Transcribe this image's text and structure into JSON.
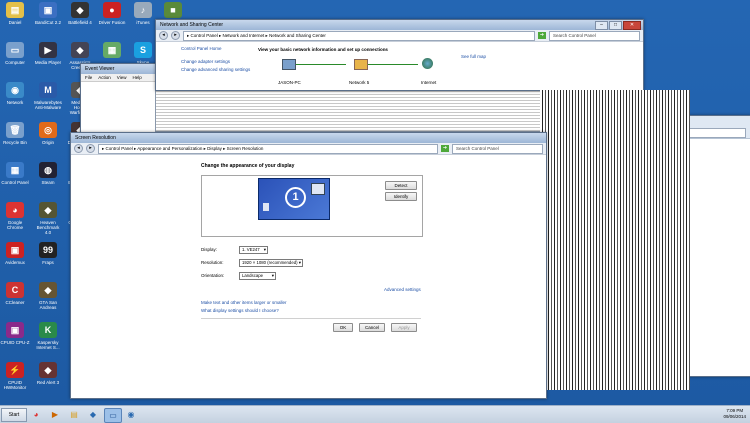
{
  "desktop": {
    "icons": [
      {
        "label": "Daniel",
        "glyph": "▤",
        "color": "#e3c04a"
      },
      {
        "label": "BandiCut 2.2",
        "glyph": "▣",
        "color": "#3b6fc2"
      },
      {
        "label": "Battlefield 4",
        "glyph": "◆",
        "color": "#333"
      },
      {
        "label": "Driver Fusion",
        "glyph": "●",
        "color": "#c22"
      },
      {
        "label": "iTunes",
        "glyph": "♪",
        "color": "#9ab"
      },
      {
        "label": "Minecraft",
        "glyph": "■",
        "color": "#5a8a3a"
      },
      {
        "label": "Computer",
        "glyph": "▭",
        "color": "#7aa0cc"
      },
      {
        "label": "Media Player",
        "glyph": "▶",
        "color": "#334"
      },
      {
        "label": "Assassin's Creed IV",
        "glyph": "◆",
        "color": "#445"
      },
      {
        "label": "",
        "glyph": "▦",
        "color": "#6a6"
      },
      {
        "label": "Skype",
        "glyph": "S",
        "color": "#1aa0e0"
      },
      {
        "label": "Speccy",
        "glyph": "▣",
        "color": "#c33"
      },
      {
        "label": "Network",
        "glyph": "◉",
        "color": "#3a8ac8"
      },
      {
        "label": "Malwarebytes Anti-Malware",
        "glyph": "M",
        "color": "#2a5aa8"
      },
      {
        "label": "Medal of Honor Warfighter",
        "glyph": "◆",
        "color": "#555"
      },
      {
        "label": "Recycle Bin",
        "glyph": "🗑",
        "color": "#7aa0cc"
      },
      {
        "label": "Origin",
        "glyph": "◎",
        "color": "#e06a1a"
      },
      {
        "label": "Dead Space",
        "glyph": "◆",
        "color": "#433"
      },
      {
        "label": "Control Panel",
        "glyph": "▦",
        "color": "#3a7ac8"
      },
      {
        "label": "Steam",
        "glyph": "◍",
        "color": "#223"
      },
      {
        "label": "Battlefield 3",
        "glyph": "◆",
        "color": "#555"
      },
      {
        "label": "Google Chrome",
        "glyph": "◕",
        "color": "#d33"
      },
      {
        "label": "Heaven Benchmark 4.0",
        "glyph": "◆",
        "color": "#553"
      },
      {
        "label": "Call of Duty",
        "glyph": "◆",
        "color": "#444"
      },
      {
        "label": "Avidemux",
        "glyph": "▣",
        "color": "#c22"
      },
      {
        "label": "Fraps",
        "glyph": "99",
        "color": "#222"
      },
      {
        "label": "Bioshock",
        "glyph": "◆",
        "color": "#446"
      },
      {
        "label": "CCleaner",
        "glyph": "C",
        "color": "#c33"
      },
      {
        "label": "GTA San Andreas",
        "glyph": "◆",
        "color": "#653"
      },
      {
        "label": "Bioshock",
        "glyph": "◆",
        "color": "#446"
      },
      {
        "label": "CPUID CPU-Z",
        "glyph": "▣",
        "color": "#8a2a8a"
      },
      {
        "label": "Kaspersky Internet S...",
        "glyph": "K",
        "color": "#2a8a4a"
      },
      {
        "label": "Crysis",
        "glyph": "◆",
        "color": "#444"
      },
      {
        "label": "CPUID HWMonitor",
        "glyph": "⚡",
        "color": "#c22"
      },
      {
        "label": "Red Alert 3",
        "glyph": "◆",
        "color": "#633"
      },
      {
        "label": "Bioshock",
        "glyph": "◆",
        "color": "#446"
      }
    ]
  },
  "network_window": {
    "title": "Network and Sharing Center",
    "breadcrumb": "▸ Control Panel ▸ Network and Internet ▸ Network and Sharing Center",
    "search_placeholder": "Search Control Panel",
    "home_link": "Control Panel Home",
    "heading": "View your basic network information and set up connections",
    "see_full_map": "See full map",
    "side_links": [
      "Change adapter settings",
      "Change advanced sharing settings"
    ],
    "nodes": [
      "JASON-PC",
      "Network 5",
      "Internet"
    ]
  },
  "event_viewer": {
    "title": "Event Viewer",
    "menu": [
      "File",
      "Action",
      "View",
      "Help"
    ]
  },
  "computer_window": {
    "search_placeholder": "Search Computer"
  },
  "screen_resolution": {
    "title": "Screen Resolution",
    "breadcrumb": "▸ Control Panel ▸ Appearance and Personalization ▸ Display ▸ Screen Resolution",
    "search_placeholder": "Search Control Panel",
    "heading": "Change the appearance of your display",
    "monitor_number": "1",
    "detect_label": "Detect",
    "identify_label": "Identify",
    "display_label": "Display:",
    "display_value": "1. VE247",
    "resolution_label": "Resolution:",
    "resolution_value": "1920 × 1080 (recommended)",
    "orientation_label": "Orientation:",
    "orientation_value": "Landscape",
    "advanced_link": "Advanced settings",
    "text_size_link": "Make text and other items larger or smaller",
    "which_settings_link": "What display settings should I choose?",
    "ok_label": "OK",
    "cancel_label": "Cancel",
    "apply_label": "Apply"
  },
  "taskbar": {
    "start_label": "Start",
    "time": "7:09 PM",
    "date": "09/06/2014",
    "apps": [
      "chrome",
      "media",
      "explorer",
      "alienware",
      "display",
      "network"
    ]
  }
}
